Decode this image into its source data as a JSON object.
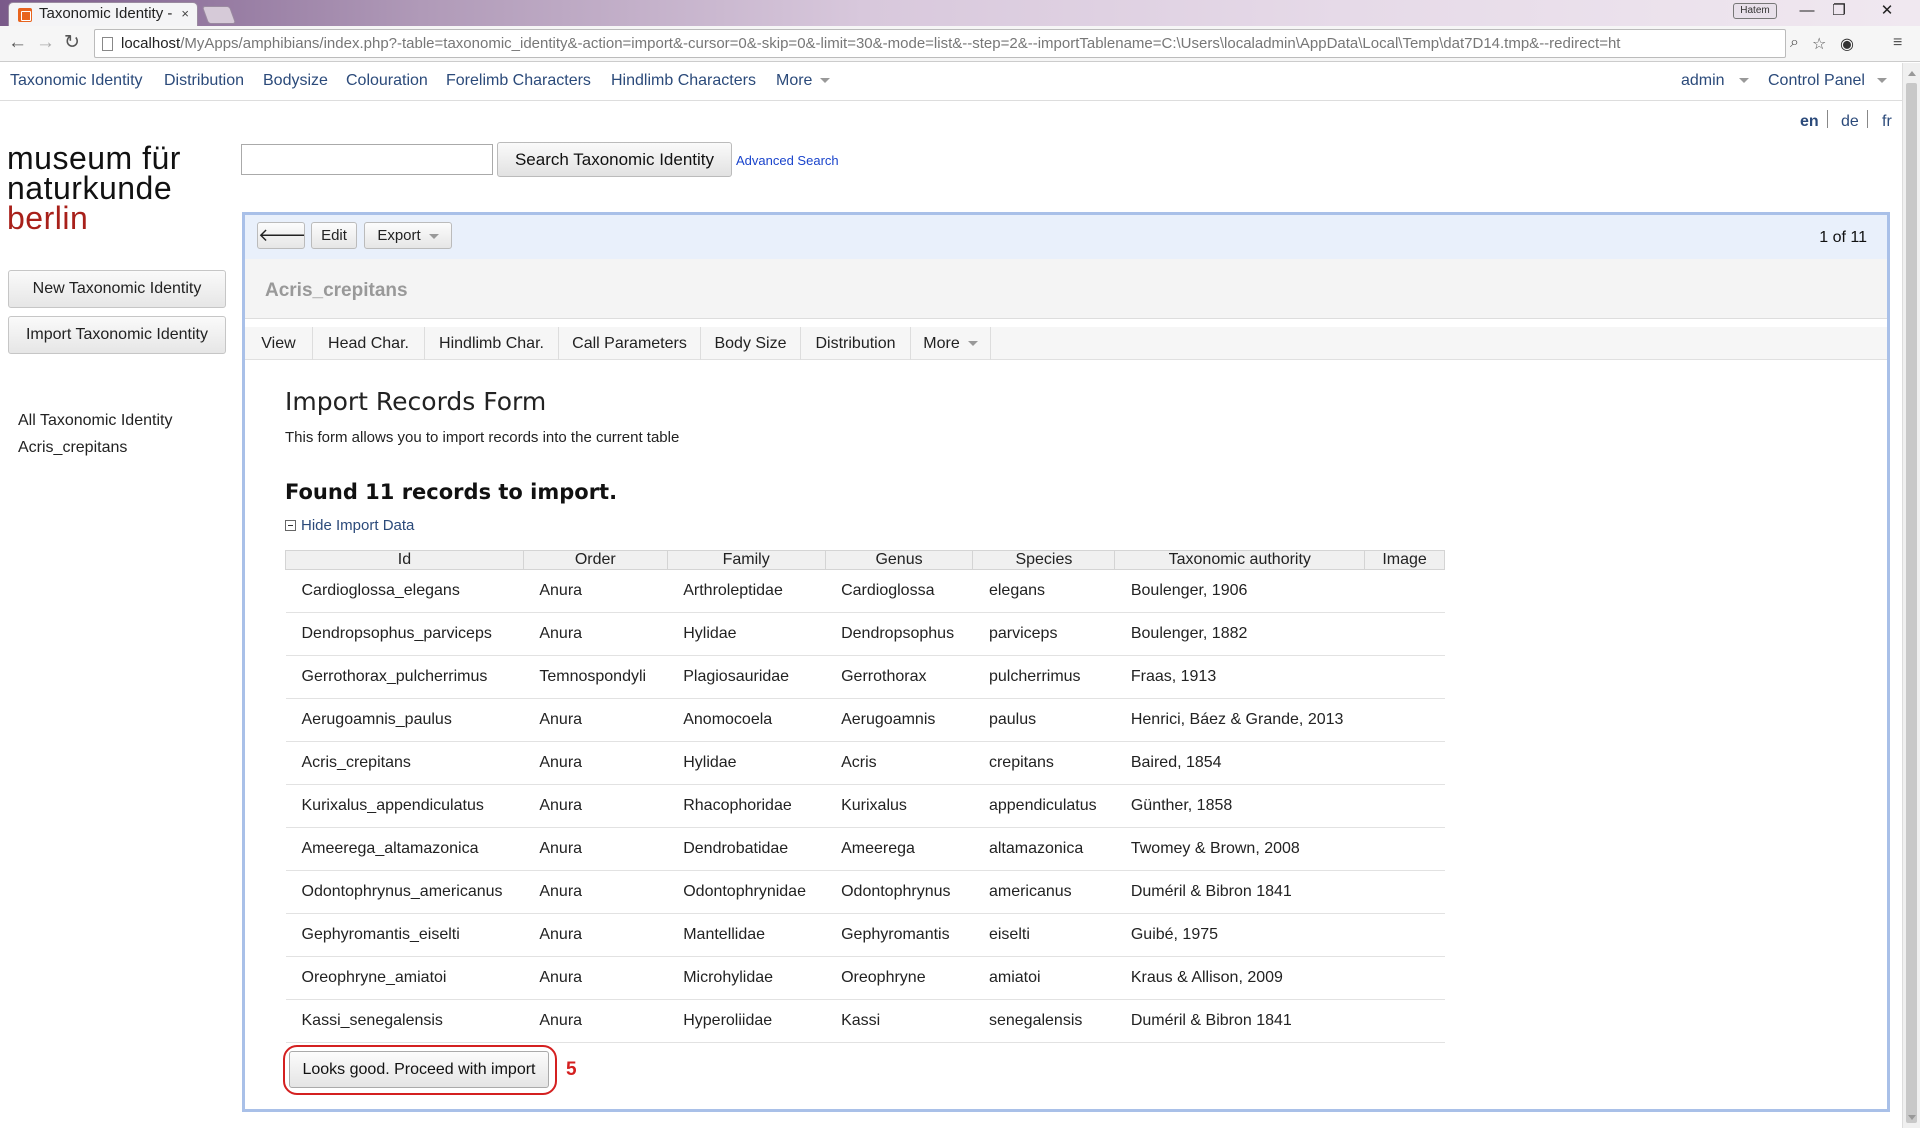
{
  "browser": {
    "tab_title": "Taxonomic Identity -",
    "tab_close": "×",
    "user_badge": "Hatem",
    "url_host": "localhost",
    "url_rest": "/MyApps/amphibians/index.php?-table=taxonomic_identity&-action=import&-cursor=0&-skip=0&-limit=30&-mode=list&--step=2&--importTablename=C:\\Users\\localadmin\\AppData\\Local\\Temp\\dat7D14.tmp&--redirect=ht",
    "back": "←",
    "forward": "→",
    "reload": "↻",
    "minimize": "—",
    "maximize": "❐",
    "close": "✕",
    "menu_icon": "≡"
  },
  "appmenu": {
    "items": [
      "Taxonomic Identity",
      "Distribution",
      "Bodysize",
      "Colouration",
      "Forelimb Characters",
      "Hindlimb Characters"
    ],
    "more": "More",
    "admin": "admin",
    "control_panel": "Control Panel"
  },
  "langs": {
    "en": "en",
    "de": "de",
    "fr": "fr"
  },
  "logo": {
    "line1": "museum für",
    "line2": "naturkunde",
    "line3": "berlin"
  },
  "sidebar": {
    "new_button": "New Taxonomic Identity",
    "import_button": "Import Taxonomic Identity",
    "links": [
      "All Taxonomic Identity",
      "Acris_crepitans"
    ]
  },
  "search": {
    "value": "",
    "button": "Search Taxonomic Identity",
    "advanced": "Advanced Search"
  },
  "record": {
    "back_icon": "🡐",
    "edit": "Edit",
    "export": "Export",
    "pager": "1 of 11",
    "title": "Acris_crepitans",
    "tabs": [
      "View",
      "Head Char.",
      "Hindlimb Char.",
      "Call Parameters",
      "Body Size",
      "Distribution",
      "More"
    ]
  },
  "form": {
    "title": "Import Records Form",
    "description": "This form allows you to import records into the current table",
    "found": "Found 11 records to import.",
    "hide_link": "Hide Import Data",
    "proceed_button": "Looks good.  Proceed with import",
    "annotation_number": "5"
  },
  "table": {
    "headers": [
      "Id",
      "Order",
      "Family",
      "Genus",
      "Species",
      "Taxonomic authority",
      "Image"
    ],
    "rows": [
      [
        "Cardioglossa_elegans",
        "Anura",
        "Arthroleptidae",
        "Cardioglossa",
        "elegans",
        "Boulenger, 1906",
        ""
      ],
      [
        "Dendropsophus_parviceps",
        "Anura",
        "Hylidae",
        "Dendropsophus",
        "parviceps",
        "Boulenger, 1882",
        ""
      ],
      [
        "Gerrothorax_pulcherrimus",
        "Temnospondyli",
        "Plagiosauridae",
        "Gerrothorax",
        "pulcherrimus",
        "Fraas, 1913",
        ""
      ],
      [
        "Aerugoamnis_paulus",
        "Anura",
        "Anomocoela",
        "Aerugoamnis",
        "paulus",
        "Henrici, Báez & Grande, 2013",
        ""
      ],
      [
        "Acris_crepitans",
        "Anura",
        "Hylidae",
        "Acris",
        "crepitans",
        "Baired, 1854",
        ""
      ],
      [
        "Kurixalus_appendiculatus",
        "Anura",
        "Rhacophoridae",
        "Kurixalus",
        "appendiculatus",
        "Günther, 1858",
        ""
      ],
      [
        "Ameerega_altamazonica",
        "Anura",
        "Dendrobatidae",
        "Ameerega",
        "altamazonica",
        "Twomey & Brown, 2008",
        ""
      ],
      [
        "Odontophrynus_americanus",
        "Anura",
        "Odontophrynidae",
        "Odontophrynus",
        "americanus",
        "Duméril & Bibron 1841",
        ""
      ],
      [
        "Gephyromantis_eiselti",
        "Anura",
        "Mantellidae",
        "Gephyromantis",
        "eiselti",
        "Guibé, 1975",
        ""
      ],
      [
        "Oreophryne_amiatoi",
        "Anura",
        "Microhylidae",
        "Oreophryne",
        "amiatoi",
        "Kraus & Allison, 2009",
        ""
      ],
      [
        "Kassi_senegalensis",
        "Anura",
        "Hyperoliidae",
        "Kassi",
        "senegalensis",
        "Duméril & Bibron 1841",
        ""
      ]
    ]
  },
  "colors": {
    "panel_border": "#a9c0e8",
    "link": "#2b4a7a",
    "logo_red": "#a8201a",
    "annotation_red": "#d42020"
  }
}
